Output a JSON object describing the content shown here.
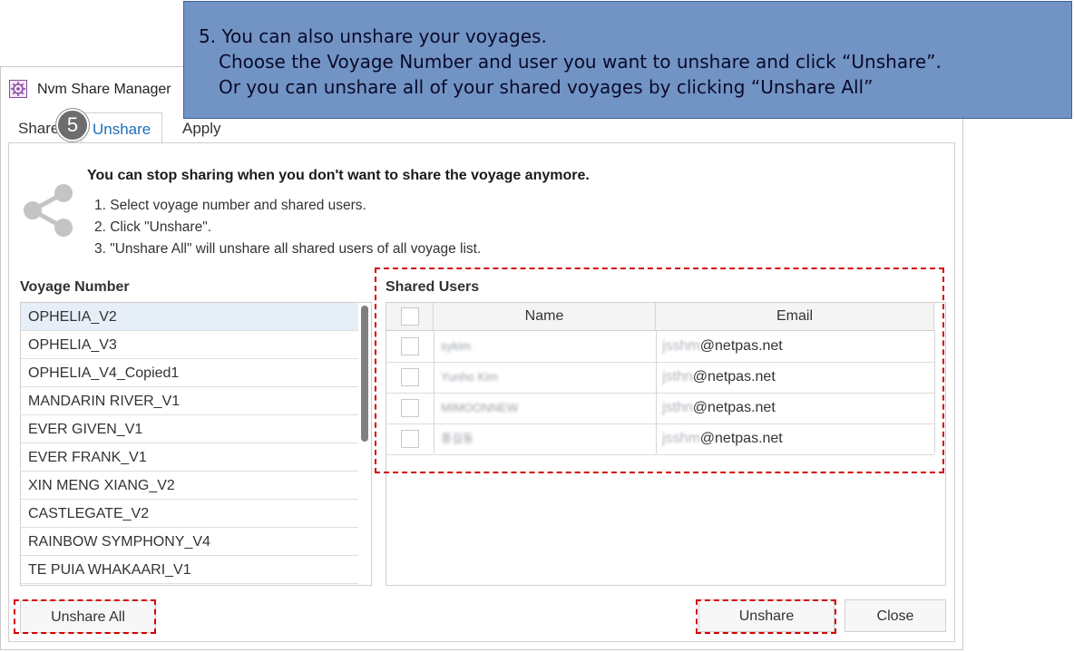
{
  "window": {
    "title": "Nvm Share Manager"
  },
  "tabs": [
    {
      "label": "Share"
    },
    {
      "label": "Unshare"
    },
    {
      "label": "Apply"
    }
  ],
  "step_badge": "5",
  "callout": {
    "line1": "5. You can also unshare your voyages.",
    "line2": "Choose the Voyage Number and user you want to unshare and click “Unshare”.",
    "line3": "Or you can unshare all of your shared voyages by clicking “Unshare All”"
  },
  "intro": {
    "headline": "You can stop sharing when you don't want to share the voyage anymore.",
    "steps": [
      "1. Select voyage number and shared users.",
      "2. Click \"Unshare\".",
      "3. \"Unshare All\" will unshare all shared users of all voyage list."
    ]
  },
  "voyages": {
    "label": "Voyage Number",
    "items": [
      "OPHELIA_V2",
      "OPHELIA_V3",
      "OPHELIA_V4_Copied1",
      "MANDARIN RIVER_V1",
      "EVER GIVEN_V1",
      "EVER FRANK_V1",
      "XIN MENG XIANG_V2",
      "CASTLEGATE_V2",
      "RAINBOW SYMPHONY_V4",
      "TE PUIA WHAKAARI_V1"
    ]
  },
  "shared_users": {
    "label": "Shared Users",
    "columns": {
      "name": "Name",
      "email": "Email"
    },
    "rows": [
      {
        "name": "sykim",
        "email_masked": "jsshm",
        "email_domain": "@netpas.net"
      },
      {
        "name": "Yunho Kim",
        "email_masked": "jsthn",
        "email_domain": "@netpas.net"
      },
      {
        "name": "MIMOONNEW",
        "email_masked": "jsthn",
        "email_domain": "@netpas.net"
      },
      {
        "name": "홍길동",
        "email_masked": "jsshm",
        "email_domain": "@netpas.net"
      }
    ]
  },
  "buttons": {
    "unshare_all": "Unshare All",
    "unshare": "Unshare",
    "close": "Close"
  },
  "colors": {
    "callout_bg": "#7294c4",
    "highlight_dash": "#d40000",
    "active_tab": "#1d6fb8",
    "selected_row": "#e6eef8"
  }
}
